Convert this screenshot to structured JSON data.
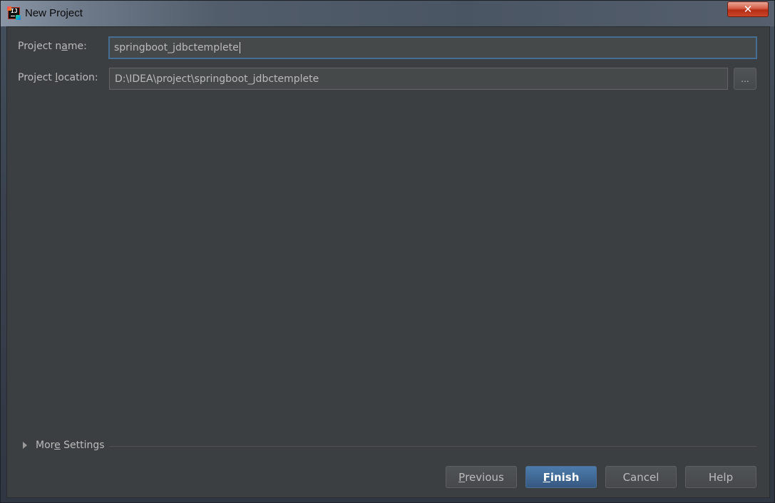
{
  "window": {
    "title": "New Project",
    "app_icon": "intellij-idea-icon",
    "close_glyph": "✕"
  },
  "form": {
    "project_name": {
      "label_before": "Project n",
      "label_mnemonic": "a",
      "label_after": "me:",
      "value": "springboot_jdbctemplete"
    },
    "project_location": {
      "label_before": "Project ",
      "label_mnemonic": "l",
      "label_after": "ocation:",
      "value": "D:\\IDEA\\project\\springboot_jdbctemplete"
    },
    "browse_label": "..."
  },
  "more_settings": {
    "label_before": "Mor",
    "label_mnemonic": "e",
    "label_after": " Settings",
    "expanded": false
  },
  "buttons": {
    "previous": {
      "mnemonic": "P",
      "rest": "revious"
    },
    "finish": {
      "mnemonic": "F",
      "rest": "inish"
    },
    "cancel": {
      "label": "Cancel"
    },
    "help": {
      "label": "Help"
    }
  },
  "colors": {
    "dialog_background": "#3c3f41",
    "focus_border": "#466d94",
    "primary_button": "#4c7bab",
    "close_button": "#c9452a"
  }
}
